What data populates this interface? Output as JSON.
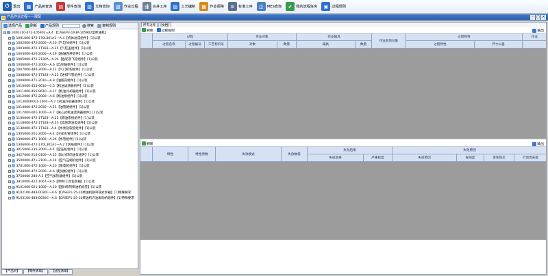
{
  "toolbar": {
    "items": [
      {
        "label": "退出",
        "icon": "power-icon",
        "color": "#1f5fb0"
      },
      {
        "label": "产品树查询",
        "icon": "product-tree-icon",
        "color": "#2f6fcf"
      },
      {
        "label": "零件查询",
        "icon": "parts-query-icon",
        "color": "#c23a3a"
      },
      {
        "label": "文档查询",
        "icon": "document-query-icon",
        "color": "#2f6fcf"
      },
      {
        "label": "作业过程",
        "icon": "process-icon",
        "color": "#5a8fd6"
      },
      {
        "label": "合并工序",
        "icon": "merge-icon",
        "color": "#6f7f95"
      },
      {
        "label": "工艺编制",
        "icon": "craft-icon",
        "color": "#2f6fcf"
      },
      {
        "label": "作业阀障",
        "icon": "barrier-icon",
        "color": "#d88a1c"
      },
      {
        "label": "标准工序",
        "icon": "standard-icon",
        "color": "#5a6f8d"
      },
      {
        "label": "MES查询",
        "icon": "mes-icon",
        "color": "#4a7fc8"
      },
      {
        "label": "我的流程任务",
        "icon": "task-icon",
        "color": "#3a9a4a"
      },
      {
        "label": "过程规则",
        "icon": "rule-icon",
        "color": "#2f6fcf"
      }
    ]
  },
  "window": {
    "title": "产品作业过程——展配"
  },
  "left": {
    "toolbar": {
      "select": "选择产品",
      "refresh": "刷新",
      "spec": "产品规则",
      "search": "搜索",
      "copy": "复制规则"
    },
    "tree_root": "1000310-472-105902=A.4 【CASEP3-1X3P-105902型柴油机】",
    "tree_items": [
      "1001000-472-170L301A1—A.4【机体总成组件】[1]公装",
      "1002000-472-2000—A.10【气缸体组件】[1]公装",
      "1003000-472-1T183—A.25【气缸盖组件】[1]公装",
      "1004000-420-2000—A.19【曲轴连杆组件】[1]公装",
      "1005000-472-2130A—A.24【齿轮及飞轮组件】[1]公装",
      "1006000-472-2000—A.6【凸轮轴组件】[1]公装",
      "1007000-480-2000—A.11【气门机构组件】[1]公装",
      "1008000-472-1T183—A.25【进排气管组件】[1]公装",
      "1009000-471-2010—A.9【油底壳组件】[1]公装",
      "1010000-455-9610—C.5【机油滤清器组件】[1]公装",
      "1011000-455-9610—A.17【机油冷却器组件】[1]公装",
      "1012000-472-2000—A.6【机油泵组件】[1]公装",
      "1013000R001-1000—A.7【机油冷却器组件】[1]公装",
      "1014000-472-2030—A.11【油管路组件】[1]公装",
      "1017000-001-1000—A.7【离心式机油滤清器组件】[1]公装",
      "1100000-472-1T183—A.25【燃油系统组件】[1]公装",
      "1118000-472-1T183—A.23【高压燃油泵组件】[1]公装",
      "1130000-472-1T183—A.4【水泵及软管组件】[1]公装",
      "1305000-201-2000—A.4【冷却水管组件】[1]公装",
      "1306000-471-1000—A.26【水管组件】[1]公装",
      "1306000-472-170L301A1—A.2【风扇组件】[1]公装",
      "3015000-235-2000—A.4【空压机组件】[1]公装",
      "3427000-214-0100—A.15【动力转向油泵组件】[1]公装",
      "3500000-471-2100—A.14【空气压缩机组件】[1]公装",
      "3701000-472-1000—A.10【发电机组件】[1]公装",
      "3708000-472-2000—A.6【起动机组件】[1]公装",
      "3750000-280-A.3【空气加热器组件】[1]公装",
      "3910000-422-1067—A.6【附件/工具包装箱】[1]公装",
      "9101000-621-1000—A.10【国III系列柴油机标签】[1]公装",
      "9102100-483-0030C—A.6【CASEP1-25-10柴油机铜带或式水箱】[1]特殊要求",
      "9103100-483-0030C—A.6【CASEP1-25-10柴油机汽油发动机组件】[1]特殊要求"
    ]
  },
  "bottom_tabs": [
    "【产品树】",
    "【零件清单】",
    "【过程清单】"
  ],
  "right": {
    "tabs": [
      "所有过程",
      "[文档]"
    ],
    "toolbar1": {
      "refresh": "刷新",
      "rule": "过程规则",
      "export": "输出"
    },
    "toolbar2": {
      "refresh": "刷新",
      "export": "输出"
    },
    "grid1_top": [
      "过程",
      "作业对象",
      "作业辅具",
      "作业前的对象",
      "过程特性",
      "作业"
    ],
    "grid1_sub": [
      "过程名称",
      "过程编号",
      "工艺标识号",
      "对象",
      "数量",
      "辅具",
      "数量",
      "过程特性",
      "尺寸公差"
    ],
    "grid2_headers": [
      "特性",
      "特性参数",
      "失效模式",
      "失效数值",
      "失效后果",
      "失效原因"
    ],
    "grid2_sub": [
      "失效后果",
      "严重程度",
      "失效原因",
      "探测度",
      "发生频次",
      "行动优先级"
    ]
  }
}
